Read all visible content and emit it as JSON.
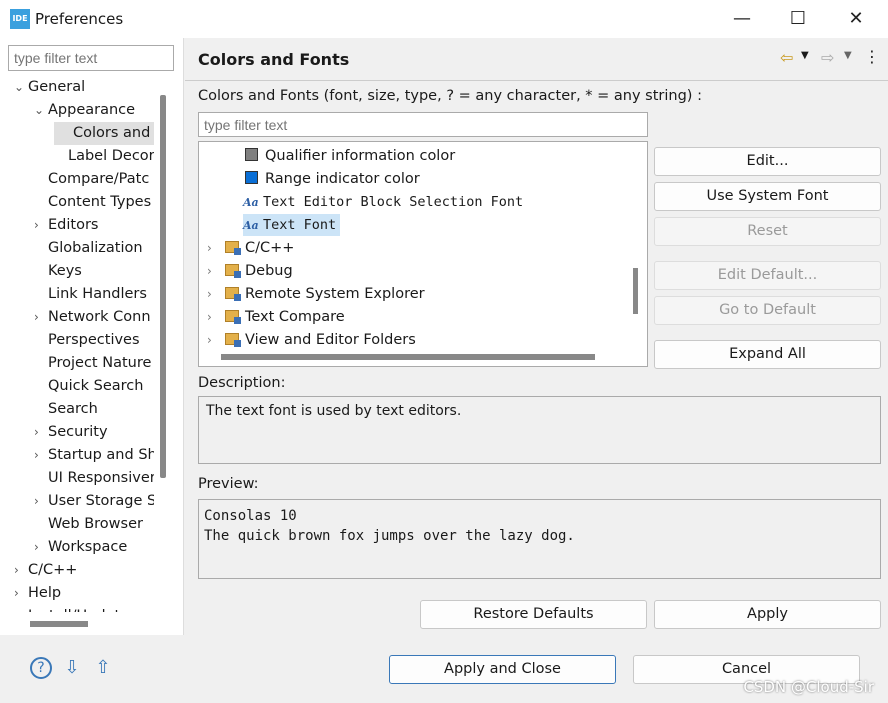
{
  "window": {
    "title": "Preferences",
    "logo": "IDE",
    "min": "—",
    "max": "☐",
    "close": "✕"
  },
  "left": {
    "filter_placeholder": "type filter text",
    "tree": [
      {
        "label": "General",
        "depth": 0,
        "tw": "open"
      },
      {
        "label": "Appearance",
        "depth": 1,
        "tw": "open"
      },
      {
        "label": "Colors and",
        "depth": 2,
        "tw": "",
        "selected": true
      },
      {
        "label": "Label Decor",
        "depth": 2,
        "tw": ""
      },
      {
        "label": "Compare/Patc",
        "depth": 1,
        "tw": ""
      },
      {
        "label": "Content Types",
        "depth": 1,
        "tw": ""
      },
      {
        "label": "Editors",
        "depth": 1,
        "tw": "closed"
      },
      {
        "label": "Globalization",
        "depth": 1,
        "tw": ""
      },
      {
        "label": "Keys",
        "depth": 1,
        "tw": ""
      },
      {
        "label": "Link Handlers",
        "depth": 1,
        "tw": ""
      },
      {
        "label": "Network Conn",
        "depth": 1,
        "tw": "closed"
      },
      {
        "label": "Perspectives",
        "depth": 1,
        "tw": ""
      },
      {
        "label": "Project Nature",
        "depth": 1,
        "tw": ""
      },
      {
        "label": "Quick Search",
        "depth": 1,
        "tw": ""
      },
      {
        "label": "Search",
        "depth": 1,
        "tw": ""
      },
      {
        "label": "Security",
        "depth": 1,
        "tw": "closed"
      },
      {
        "label": "Startup and Sh",
        "depth": 1,
        "tw": "closed"
      },
      {
        "label": "UI Responsiver",
        "depth": 1,
        "tw": ""
      },
      {
        "label": "User Storage S",
        "depth": 1,
        "tw": "closed"
      },
      {
        "label": "Web Browser",
        "depth": 1,
        "tw": ""
      },
      {
        "label": "Workspace",
        "depth": 1,
        "tw": "closed"
      },
      {
        "label": "C/C++",
        "depth": 0,
        "tw": "closed"
      },
      {
        "label": "Help",
        "depth": 0,
        "tw": "closed"
      },
      {
        "label": "Install/Update",
        "depth": 0,
        "tw": "closed"
      }
    ]
  },
  "page": {
    "title": "Colors and Fonts",
    "nav_back": "⇦",
    "nav_fwd": "⇨",
    "menu": "⋮",
    "instructions": "Colors and Fonts (font, size, type, ? = any character, * = any string) :",
    "filter_placeholder": "type filter text",
    "items": [
      {
        "label": "Qualifier information color",
        "kind": "color",
        "color": "#808080"
      },
      {
        "label": "Range indicator color",
        "kind": "color",
        "color": "#0a6fd6"
      },
      {
        "label": "Text Editor Block Selection Font",
        "kind": "font"
      },
      {
        "label": "Text Font",
        "kind": "font",
        "selected": true
      },
      {
        "label": "C/C++",
        "kind": "category"
      },
      {
        "label": "Debug",
        "kind": "category"
      },
      {
        "label": "Remote System Explorer",
        "kind": "category"
      },
      {
        "label": "Text Compare",
        "kind": "category"
      },
      {
        "label": "View and Editor Folders",
        "kind": "category"
      }
    ],
    "buttons": {
      "edit": "Edit...",
      "system_font": "Use System Font",
      "reset": "Reset",
      "edit_default": "Edit Default...",
      "go_default": "Go to Default",
      "expand_all": "Expand All"
    },
    "description_label": "Description:",
    "description": "The text font is used by text editors.",
    "preview_label": "Preview:",
    "preview_line1": "Consolas 10",
    "preview_line2": "The quick brown fox jumps over the lazy dog.",
    "restore": "Restore Defaults",
    "apply": "Apply"
  },
  "footer": {
    "apply_close": "Apply and Close",
    "cancel": "Cancel",
    "watermark": "CSDN @Cloud-Sir"
  }
}
